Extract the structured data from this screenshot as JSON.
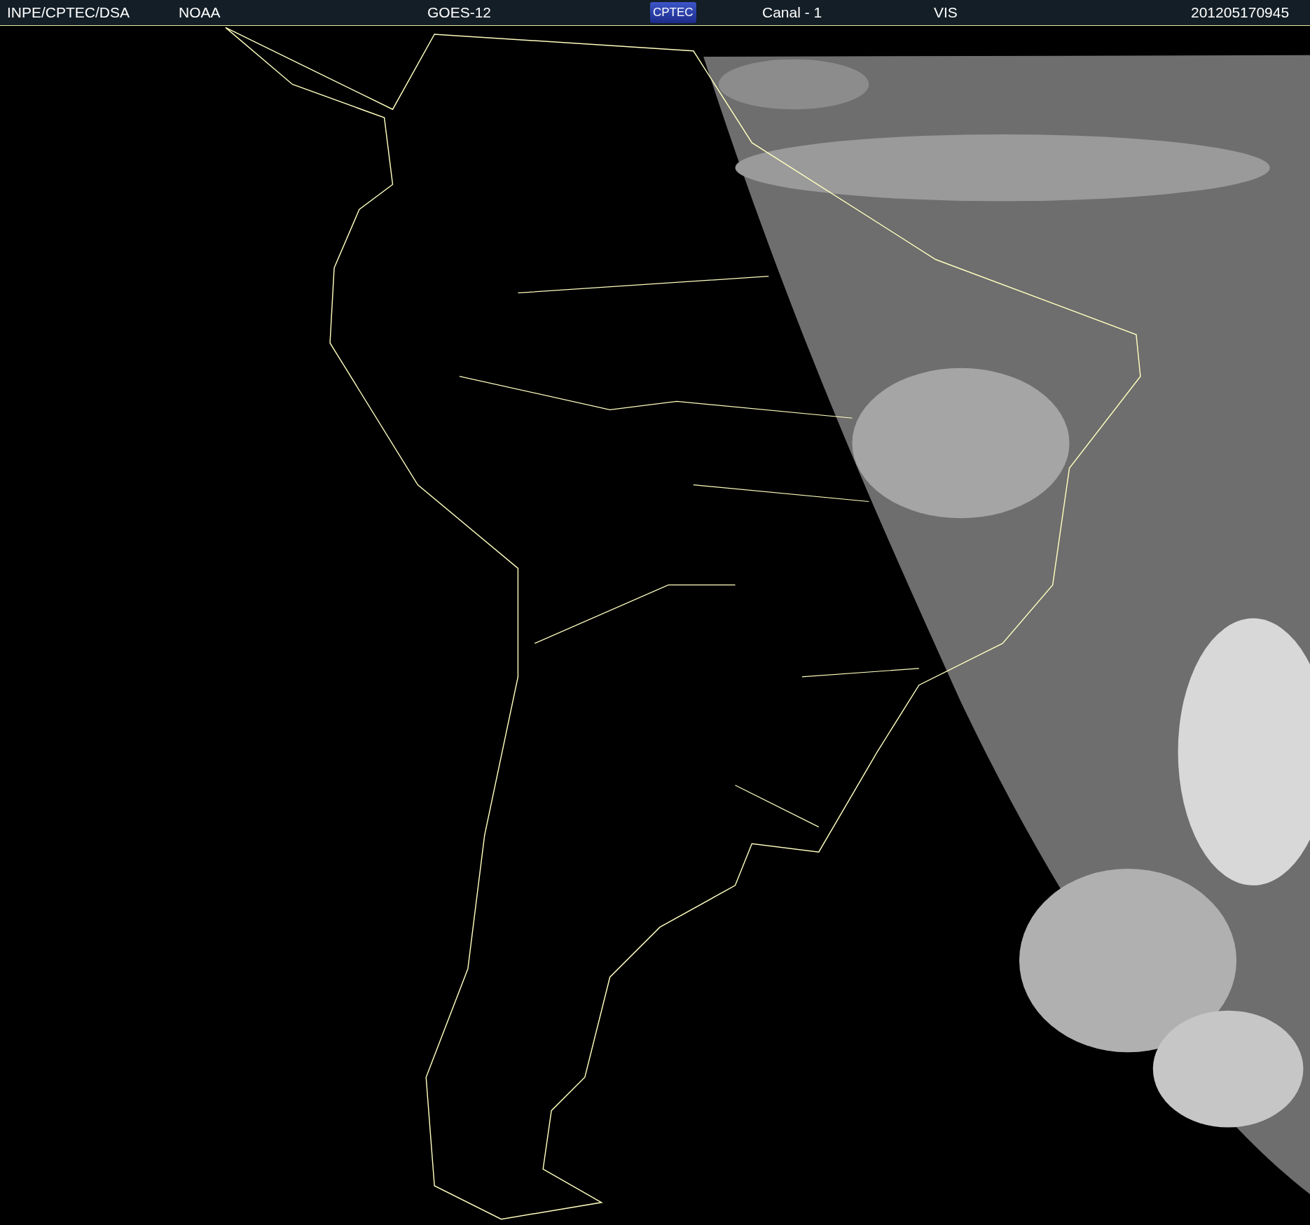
{
  "header": {
    "items": [
      {
        "kind": "text",
        "text": "INPE/CPTEC/DSA"
      },
      {
        "kind": "text",
        "text": "NOAA"
      },
      {
        "kind": "text",
        "text": "GOES-12"
      },
      {
        "kind": "logo",
        "text": "CPTEC"
      },
      {
        "kind": "text",
        "text": "Canal - 1"
      },
      {
        "kind": "text",
        "text": "VIS"
      },
      {
        "kind": "text",
        "text": "201205170945"
      }
    ]
  }
}
